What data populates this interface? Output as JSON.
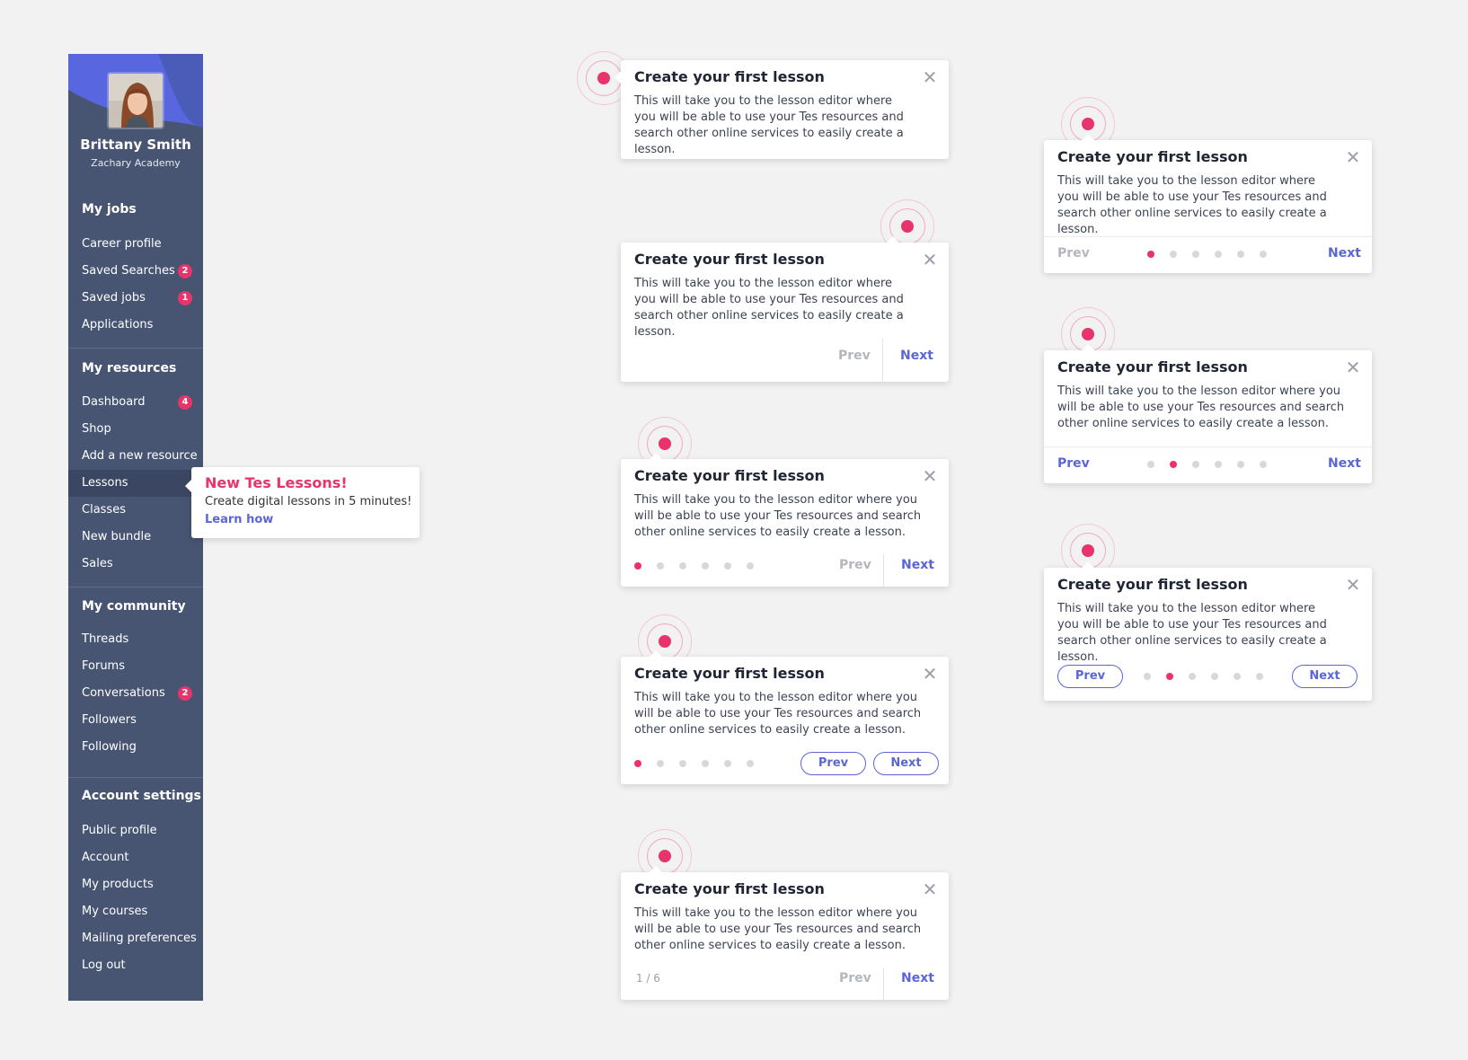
{
  "user": {
    "name": "Brittany Smith",
    "school": "Zachary Academy"
  },
  "sidebar": {
    "sections": [
      {
        "title": "My jobs",
        "items": [
          {
            "label": "Career profile",
            "badge": ""
          },
          {
            "label": "Saved Searches",
            "badge": "2"
          },
          {
            "label": "Saved jobs",
            "badge": "1"
          },
          {
            "label": "Applications",
            "badge": ""
          }
        ]
      },
      {
        "title": "My resources",
        "items": [
          {
            "label": "Dashboard",
            "badge": "4"
          },
          {
            "label": "Shop",
            "badge": ""
          },
          {
            "label": "Add a new resource",
            "badge": ""
          },
          {
            "label": "Lessons",
            "badge": ""
          },
          {
            "label": "Classes",
            "badge": ""
          },
          {
            "label": "New bundle",
            "badge": ""
          },
          {
            "label": "Sales",
            "badge": ""
          }
        ]
      },
      {
        "title": "My community",
        "items": [
          {
            "label": "Threads",
            "badge": ""
          },
          {
            "label": "Forums",
            "badge": ""
          },
          {
            "label": "Conversations",
            "badge": "2"
          },
          {
            "label": "Followers",
            "badge": ""
          },
          {
            "label": "Following",
            "badge": ""
          }
        ]
      },
      {
        "title": "Account settings",
        "items": [
          {
            "label": "Public profile",
            "badge": ""
          },
          {
            "label": "Account",
            "badge": ""
          },
          {
            "label": "My products",
            "badge": ""
          },
          {
            "label": "My courses",
            "badge": ""
          },
          {
            "label": "Mailing preferences",
            "badge": ""
          },
          {
            "label": "Log out",
            "badge": ""
          }
        ]
      }
    ]
  },
  "promo": {
    "title": "New Tes Lessons!",
    "text": "Create digital lessons in 5 minutes!",
    "link": "Learn how"
  },
  "tour": {
    "title": "Create your first lesson",
    "body": "This will take you to the lesson editor where you will be able to use your Tes resources and search other online services to easily create a lesson.",
    "prev": "Prev",
    "next": "Next",
    "counter": "1 / 6",
    "total_steps": 6
  },
  "colors": {
    "accent": "#5a66d6",
    "highlight": "#e8336b",
    "sidebar": "#475573",
    "background": "#f2f2f2"
  }
}
